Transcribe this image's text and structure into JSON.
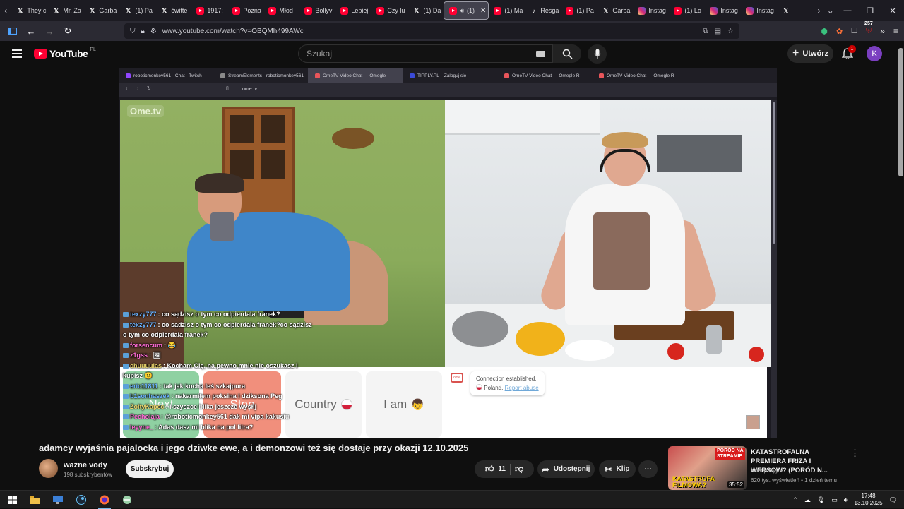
{
  "browser": {
    "tabs": [
      {
        "label": "They c",
        "icon": "x-icon",
        "type": "x"
      },
      {
        "label": "Mr. Za",
        "icon": "x-icon",
        "type": "x"
      },
      {
        "label": "Garba",
        "icon": "x-icon",
        "type": "x"
      },
      {
        "label": "(1) Pa",
        "icon": "x-icon",
        "type": "x"
      },
      {
        "label": "ćwitte",
        "icon": "x-icon",
        "type": "x"
      },
      {
        "label": "1917:",
        "icon": "youtube-icon",
        "type": "yt"
      },
      {
        "label": "Pozna",
        "icon": "youtube-icon",
        "type": "yt"
      },
      {
        "label": "Młod",
        "icon": "youtube-icon",
        "type": "yt"
      },
      {
        "label": "Bollyv",
        "icon": "youtube-icon",
        "type": "yt"
      },
      {
        "label": "Lepiej",
        "icon": "youtube-icon",
        "type": "yt"
      },
      {
        "label": "Czy lu",
        "icon": "youtube-icon",
        "type": "yt"
      },
      {
        "label": "(1) Da",
        "icon": "x-icon",
        "type": "x"
      },
      {
        "label": "(1)",
        "icon": "youtube-icon",
        "type": "yt",
        "active": true
      },
      {
        "label": "(1) Ma",
        "icon": "youtube-icon",
        "type": "yt"
      },
      {
        "label": "Resga",
        "icon": "tiktok-icon",
        "type": "tt"
      },
      {
        "label": "(1) Pa",
        "icon": "youtube-icon",
        "type": "yt"
      },
      {
        "label": "Garba",
        "icon": "x-icon",
        "type": "x"
      },
      {
        "label": "Instag",
        "icon": "instagram-icon",
        "type": "ig"
      },
      {
        "label": "(1) Lo",
        "icon": "youtube-icon",
        "type": "yt"
      },
      {
        "label": "Instag",
        "icon": "instagram-icon",
        "type": "ig"
      },
      {
        "label": "Instag",
        "icon": "instagram-icon",
        "type": "ig"
      },
      {
        "label": "",
        "icon": "x-icon",
        "type": "x"
      }
    ],
    "url": "www.youtube.com/watch?v=OBQMh499AWc",
    "extension_badge": "257"
  },
  "youtube": {
    "logo_text": "YouTube",
    "logo_country": "PL",
    "search_placeholder": "Szukaj",
    "create_label": "Utwórz",
    "notification_count": "1",
    "avatar_letter": "K"
  },
  "video": {
    "inner_tabs": [
      {
        "label": "roboticmonkey561 - Chat - Twitch",
        "color": "#9146ff"
      },
      {
        "label": "StreamElements - roboticmonkey561",
        "color": "#8a8a8a"
      },
      {
        "label": "OmeTV Video Chat — Omegle",
        "color": "#e8555a",
        "active": true
      },
      {
        "label": "TIPPLY.PL – Zaloguj się",
        "color": "#3b4bd8"
      },
      {
        "label": "OmeTV Video Chat — Omegle R",
        "color": "#e8555a"
      },
      {
        "label": "OmeTV Video Chat — Omegle R",
        "color": "#e8555a"
      }
    ],
    "inner_url": "ome.tv",
    "ome_logo": "Ome.tv",
    "chat": [
      {
        "nick": "texzy777",
        "color": "#6bb3ff",
        "text": "co sądzisz o tym co odpierdala franek?"
      },
      {
        "nick": "texzy777",
        "color": "#6bb3ff",
        "text": "co sądzisz o tym co odpierdala franek?co sądzisz"
      },
      {
        "nick": "",
        "color": "#ffffff",
        "text": "o tym co odpierdala franek?"
      },
      {
        "nick": "forsencum",
        "color": "#ff6bd6",
        "text": "😂"
      },
      {
        "nick": "z1gss",
        "color": "#ff6bd6",
        "text": "🖼"
      },
      {
        "nick": "chuuuuias",
        "color": "#e8d36b",
        "text": "Kocham Cię, na pewno mnie nie oszukasz i"
      },
      {
        "nick": "",
        "color": "#ffffff",
        "text": "kupisz 🙂"
      },
      {
        "nick": "eric11811",
        "color": "#6bb3ff",
        "text": "tak jak kocha leś szkajpura"
      },
      {
        "nick": "b1sonhaszek",
        "color": "#6bb3ff",
        "text": "nakarmiłem poksina i dziksona Peg"
      },
      {
        "nick": "ZoltyKapec",
        "color": "#e8d36b",
        "text": "i szyszce blika jeszcze wysłij"
      },
      {
        "nick": "Pecholaja",
        "color": "#ff6bd6",
        "text": "@roboticmonkey561 dak mi vipa kakusiu"
      },
      {
        "nick": "leyyne_",
        "color": "#ff6bd6",
        "text": "Adas dasz mi blika na pol litra?"
      }
    ],
    "buttons": {
      "next": "Next",
      "stop": "Stop",
      "country": "Country",
      "iam": "I am"
    },
    "status": {
      "line1": "Connection established.",
      "country": "Poland.",
      "report": "Report abuse"
    }
  },
  "watch": {
    "title": "adamcy wyjaśnia pajalocka i jego dziwke ewe, a i demonzowi też się dostaje przy okazji 12.10.2025",
    "channel_name": "ważne vody",
    "subscribers": "198 subskrybentów",
    "subscribe_label": "Subskrybuj",
    "likes": "11",
    "share_label": "Udostępnij",
    "clip_label": "Klip"
  },
  "recommendation": {
    "title": "KATASTROFALNA PREMIERA FRIZA I WERSOW? (PORÓD N...",
    "channel": "Konopskyy",
    "meta": "620 tys. wyświetleń • 1 dzień temu",
    "duration": "35:52",
    "thumb_overlay_top": "PORÓD NA STREAMIE",
    "thumb_overlay_bottom": "KATASTROFA FILMOWA?"
  },
  "taskbar": {
    "time": "17:48",
    "date": "13.10.2025"
  }
}
